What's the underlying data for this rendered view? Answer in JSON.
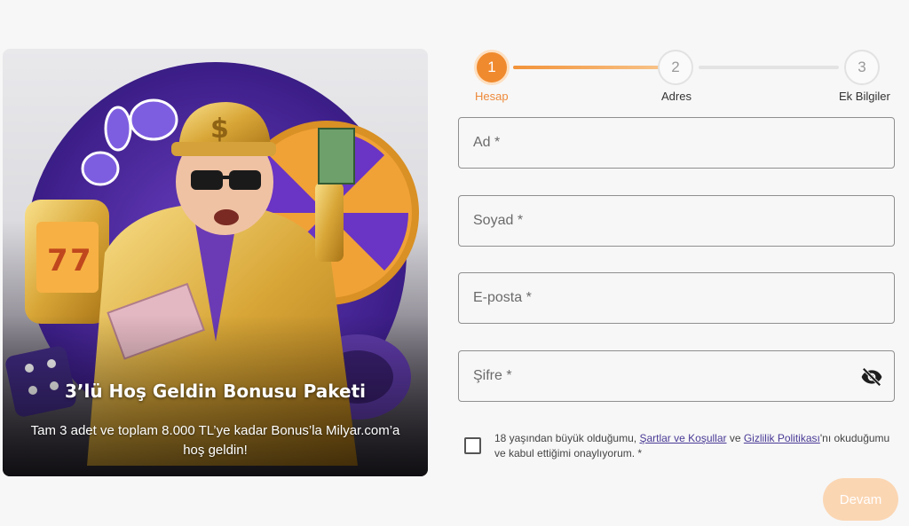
{
  "promo": {
    "title": "3’lü Hoş Geldin Bonusu Paketi",
    "subtitle": "Tam 3 adet ve toplam 8.000 TL’ye kadar Bonus’la Milyar.com’a hoş geldin!"
  },
  "stepper": {
    "steps": [
      {
        "number": "1",
        "label": "Hesap",
        "state": "active"
      },
      {
        "number": "2",
        "label": "Adres",
        "state": "idle"
      },
      {
        "number": "3",
        "label": "Ek Bilgiler",
        "state": "idle"
      }
    ],
    "accent": "#f08a2e"
  },
  "form": {
    "first_name_placeholder": "Ad *",
    "last_name_placeholder": "Soyad *",
    "email_placeholder": "E-posta *",
    "password_placeholder": "Şifre *"
  },
  "terms": {
    "text_before": "18 yaşından büyük olduğumu, ",
    "terms_link": "Şartlar ve Koşullar",
    "text_middle": " ve ",
    "privacy_link": "Gizlilik Politikası",
    "text_after": "'nı okuduğumu ve kabul ettiğimi onaylıyorum. *"
  },
  "actions": {
    "continue_label": "Devam",
    "continue_color": "#fbd6b3"
  }
}
